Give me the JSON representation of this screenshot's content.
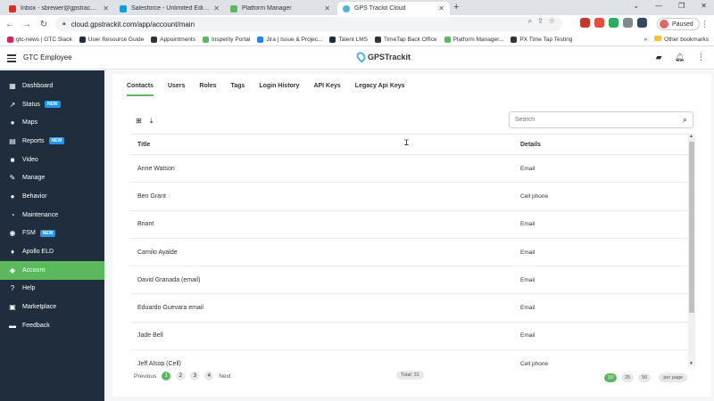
{
  "browser": {
    "tabs": [
      {
        "label": "Inbox - sbrewer@gpstrackit.com",
        "color": "#d93025"
      },
      {
        "label": "Salesforce - Unlimited Edition",
        "color": "#00a1e0"
      },
      {
        "label": "Platform Manager",
        "color": "#5cb85c"
      },
      {
        "label": "GPS Trackit Cloud",
        "color": "#4fb3d9"
      }
    ],
    "url": "cloud.gpstrackit.com/app/account/main",
    "profile_label": "Paused",
    "bookmarks": [
      "gtc-news | GTC Slack",
      "User Resource Guide",
      "Appointments",
      "Insperity Portal",
      "Jira | Issue & Projec...",
      "Talent LMS",
      "TimeTap Back Office",
      "Platform Manager...",
      "PX Time Tap Testing"
    ],
    "other_bookmarks": "Other bookmarks"
  },
  "header": {
    "org_name": "GTC Employee",
    "logo_text": "GPSTrackit"
  },
  "sidebar": {
    "items": [
      {
        "label": "Dashboard",
        "icon": "dashboard-icon",
        "glyph": "▦",
        "badge": ""
      },
      {
        "label": "Status",
        "icon": "status-icon",
        "glyph": "↗",
        "badge": "NEW"
      },
      {
        "label": "Maps",
        "icon": "map-pin-icon",
        "glyph": "●",
        "badge": ""
      },
      {
        "label": "Reports",
        "icon": "reports-icon",
        "glyph": "▤",
        "badge": "NEW"
      },
      {
        "label": "Video",
        "icon": "video-icon",
        "glyph": "■",
        "badge": ""
      },
      {
        "label": "Manage",
        "icon": "wrench-icon",
        "glyph": "✎",
        "badge": ""
      },
      {
        "label": "Behavior",
        "icon": "person-icon",
        "glyph": "●",
        "badge": ""
      },
      {
        "label": "Maintenance",
        "icon": "maintenance-icon",
        "glyph": "◔",
        "badge": ""
      },
      {
        "label": "FSM",
        "icon": "fsm-icon",
        "glyph": "◉",
        "badge": "NEW"
      },
      {
        "label": "Apollo ELD",
        "icon": "eld-icon",
        "glyph": "♦",
        "badge": ""
      },
      {
        "label": "Account",
        "icon": "account-icon",
        "glyph": "◆",
        "badge": ""
      },
      {
        "label": "Help",
        "icon": "help-icon",
        "glyph": "?",
        "badge": ""
      },
      {
        "label": "Marketplace",
        "icon": "marketplace-icon",
        "glyph": "▣",
        "badge": ""
      },
      {
        "label": "Feedback",
        "icon": "feedback-icon",
        "glyph": "▬",
        "badge": ""
      }
    ],
    "active_index": 10
  },
  "account": {
    "tabs": [
      "Contacts",
      "Users",
      "Roles",
      "Tags",
      "Login History",
      "API Keys",
      "Legacy Api Keys"
    ],
    "active_tab": 0,
    "search_placeholder": "Search",
    "columns": {
      "title": "Title",
      "details": "Details"
    },
    "rows": [
      {
        "title": "Anne Watson",
        "details": "Email"
      },
      {
        "title": "Ben Grant",
        "details": "Cell phone"
      },
      {
        "title": "Briant",
        "details": "Email"
      },
      {
        "title": "Camilo Ayalde",
        "details": "Email"
      },
      {
        "title": "David Granada (email)",
        "details": "Email"
      },
      {
        "title": "Eduardo Guevara email",
        "details": "Email"
      },
      {
        "title": "Jade Bell",
        "details": "Email"
      },
      {
        "title": "Jeff Alsop (Cell)",
        "details": "Cell phone"
      }
    ],
    "pagination": {
      "previous": "Previous",
      "pages": [
        "1",
        "2",
        "3",
        "4"
      ],
      "current": "1",
      "next": "Next",
      "total": "Total: 31",
      "sizes": [
        "10",
        "25",
        "50"
      ],
      "active_size": "10",
      "per_page": "per page"
    }
  },
  "colors": {
    "sidebar_bg": "#1f2d3d",
    "accent_green": "#5cb85c",
    "badge_blue": "#2196f3"
  }
}
